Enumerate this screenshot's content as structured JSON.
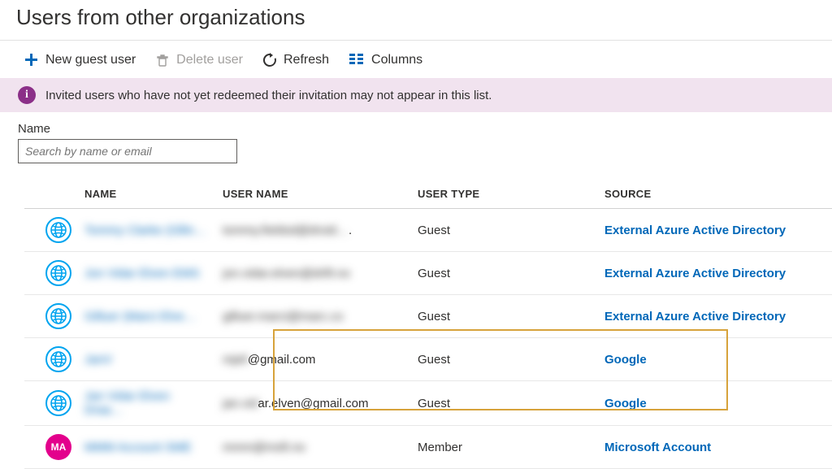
{
  "page": {
    "title": "Users from other organizations"
  },
  "toolbar": {
    "new_guest": "New guest user",
    "delete_user": "Delete user",
    "refresh": "Refresh",
    "columns": "Columns"
  },
  "banner": {
    "text": "Invited users who have not yet redeemed their invitation may not appear in this list."
  },
  "filter": {
    "label": "Name",
    "placeholder": "Search by name or email"
  },
  "table": {
    "headers": {
      "name": "NAME",
      "user_name": "USER NAME",
      "user_type": "USER TYPE",
      "source": "SOURCE"
    },
    "rows": [
      {
        "icon": "globe",
        "name_blur": "Tommy Clarke (Gllin…",
        "uname_blur": "tommy.fieldsd@droid…",
        "uname_visible": ".",
        "type": "Guest",
        "source": "External Azure Active Directory"
      },
      {
        "icon": "globe",
        "name_blur": "Jon Vidar Elven EMS",
        "uname_blur": "jon.vidar.elven@drift.no",
        "type": "Guest",
        "source": "External Azure Active Directory"
      },
      {
        "icon": "globe",
        "name_blur": "Gilluer (Marci Elve…",
        "uname_blur": "gilluer.marci@marc.co",
        "type": "Guest",
        "source": "External Azure Active Directory"
      },
      {
        "icon": "globe",
        "name_blur": "JanV",
        "uname_blur": "mjeli",
        "uname_visible": "@gmail.com",
        "type": "Guest",
        "source": "Google"
      },
      {
        "icon": "globe",
        "name_blur": "Jan Vidar Elven Draa…",
        "uname_blur": "jan.vid",
        "uname_visible": "ar.elven@gmail.com",
        "type": "Guest",
        "source": "Google"
      },
      {
        "icon": "initials",
        "initials": "MA",
        "name_blur": "MMM Account SME",
        "uname_blur": "mmm@msft.no",
        "type": "Member",
        "source": "Microsoft Account"
      }
    ]
  },
  "colors": {
    "accent": "#0067b8",
    "azure": "#00a4ef",
    "banner_bg": "#f1e3ef",
    "info": "#8b2f88",
    "highlight": "#d7a33b",
    "pink": "#e3008c"
  }
}
